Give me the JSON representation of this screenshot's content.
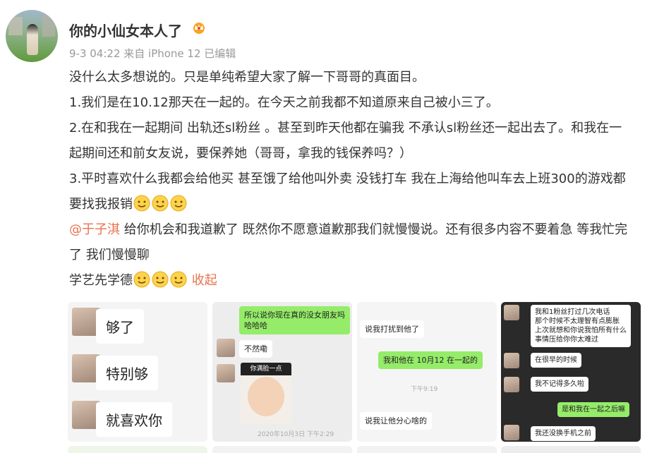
{
  "post": {
    "author": "你的小仙女本人了",
    "meta": "9-3 04:22 来自 iPhone 12 已编辑",
    "lines": [
      "没什么太多想说的。只是单纯希望大家了解一下哥哥的真面目。",
      "1.我们是在10.12那天在一起的。在今天之前我都不知道原来自己被小三了。",
      "2.在和我在一起期间 出轨还sl粉丝 。甚至到昨天他都在骗我 不承认sl粉丝还一起出去了。和我在一起期间还和前女友说，要保养她（哥哥，拿我的钱保养吗？）",
      "3.平时喜欢什么我都会给他买 甚至饿了给他叫外卖 没钱打车 我在上海给他叫车去上班300的游戏都要找我报销"
    ],
    "mention": "@于子淇",
    "mention_text": " 给你机会和我道歉了 既然你不愿意道歉那我们就慢慢说。还有很多内容不要着急 等我忙完了 我们慢慢聊",
    "closing": "学艺先学德",
    "collapse": "收起"
  },
  "images": {
    "img1": {
      "b1": "够了",
      "b2": "特别够",
      "b3": "就喜欢你"
    },
    "img2": {
      "b1": "所以说你现在真的没女朋友吗\n哈哈哈",
      "b2": "不然嘞",
      "sticker": "你满脸一点",
      "time": "2020年10月3日 下午2:29"
    },
    "img3": {
      "b1": "说我打扰到他了",
      "b2": "我和他在 10月12 在一起的",
      "time": "下午9:19",
      "b3": "说我让他分心啥的"
    },
    "img4": {
      "b1": "我和1粉丝打过几次电话\n那个时候不太理智有点膨胀\n上次就想和你说我怕所有什么\n事情压给你你太难过",
      "b2": "在很早的时候",
      "b3": "我不记得多久啦",
      "b4": "是和我在一起之后嘛",
      "b5": "我还没换手机之前"
    }
  },
  "colors": {
    "accent": "#eb7350",
    "wechat_green": "#95ec69"
  }
}
